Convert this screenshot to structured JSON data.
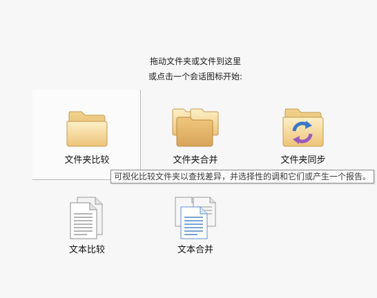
{
  "instructions": {
    "line1": "拖动文件夹或文件到这里",
    "line2": "或点击一个会话图标开始:"
  },
  "sessions": {
    "folder_compare": {
      "label": "文件夹比较",
      "icon": "folder-icon"
    },
    "folder_merge": {
      "label": "文件夹合并",
      "icon": "folder-merge-icon"
    },
    "folder_sync": {
      "label": "文件夹同步",
      "icon": "folder-sync-icon"
    },
    "text_compare": {
      "label": "文本比较",
      "icon": "text-document-icon"
    },
    "text_merge": {
      "label": "文本合并",
      "icon": "text-merge-icon"
    }
  },
  "tooltip": {
    "text": "可视化比较文件夹以查找差异，并选择性的调和它们或产生一个报告。"
  },
  "colors": {
    "folder_light": "#fbe3a8",
    "folder_dark": "#e7b964",
    "sync_blue": "#3a78c8",
    "sync_purple": "#9a59b8",
    "doc_blue": "#4a84c4"
  }
}
